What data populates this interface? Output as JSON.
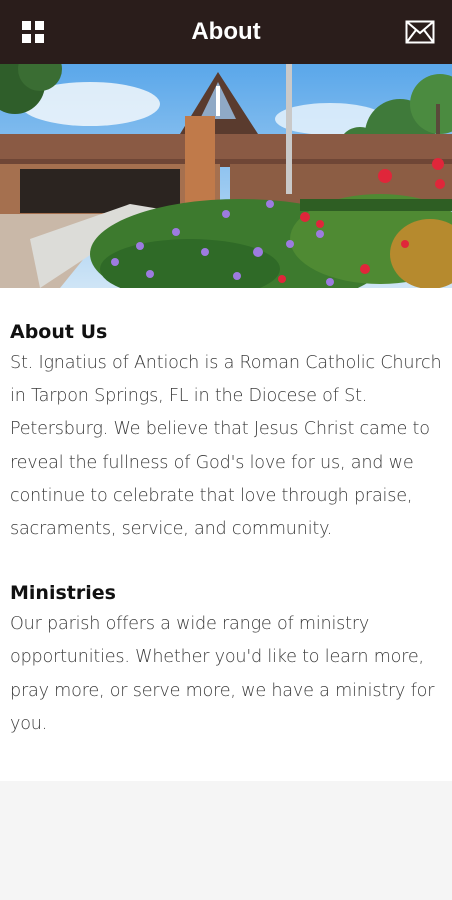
{
  "header": {
    "title": "About",
    "background": "#2a1d1b",
    "menu_icon": "grid-menu-icon",
    "mail_icon": "mail-icon"
  },
  "hero": {
    "image_description_icon": "church-photo"
  },
  "sections": [
    {
      "heading": "About Us",
      "body": "St. Ignatius of Antioch is a Roman Catholic Church in Tarpon Springs, FL in the Diocese of St. Petersburg. We believe that Jesus Christ came to reveal the fullness of God's love for us, and we continue to celebrate that love through praise, sacraments, service, and community."
    },
    {
      "heading": "Ministries",
      "body": "Our parish offers a wide range of ministry opportunities. Whether you'd like to learn more, pray more, or serve more, we have a ministry for you."
    }
  ]
}
